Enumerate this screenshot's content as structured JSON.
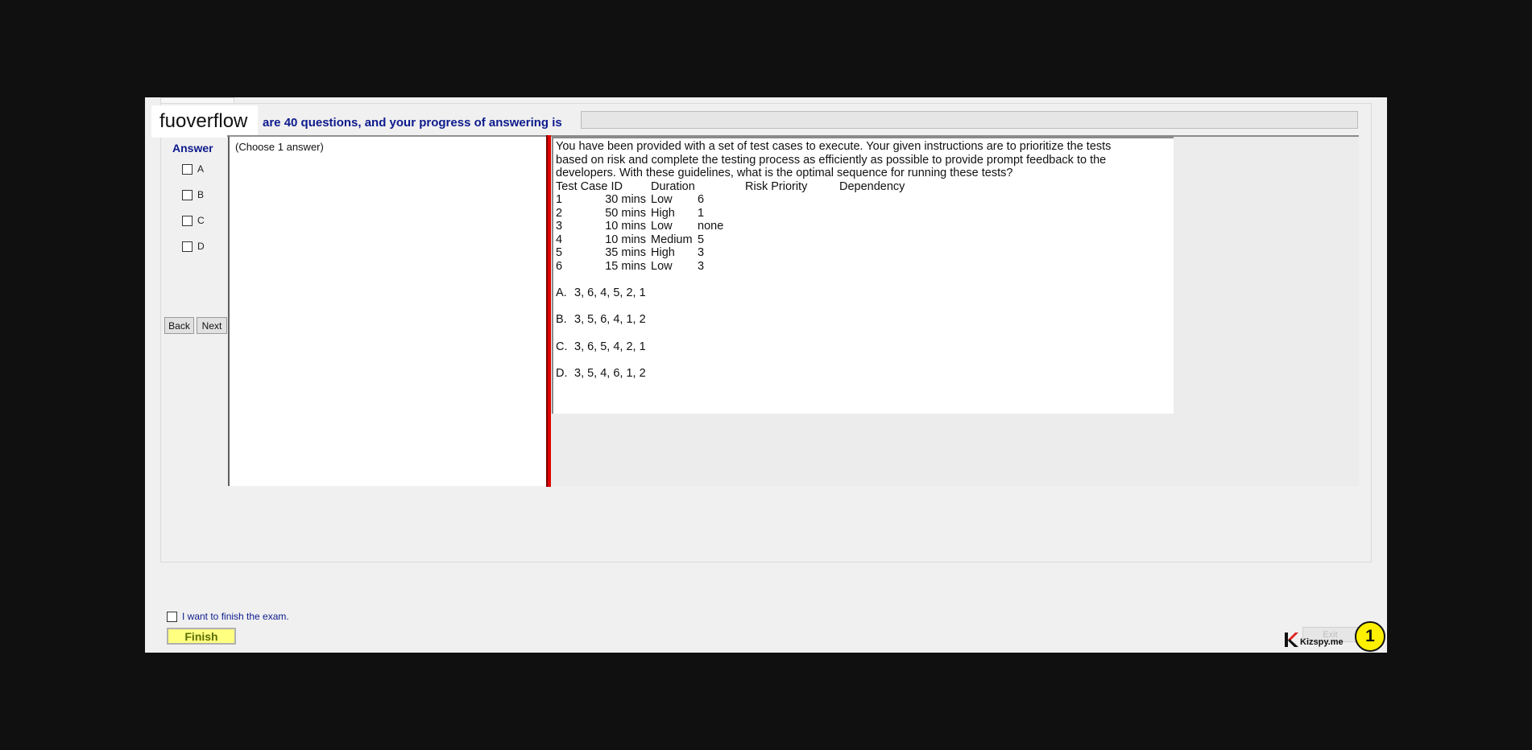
{
  "header": {
    "brand": "fuoverflow",
    "progress_label": "are 40 questions, and your progress of answering is",
    "progress_fraction": 0
  },
  "answer": {
    "title": "Answer",
    "options": [
      "A",
      "B",
      "C",
      "D"
    ],
    "choose_hint": "(Choose 1 answer)"
  },
  "nav": {
    "back_label": "Back",
    "next_label": "Next"
  },
  "question": {
    "text": "You have been provided with a set of test cases to execute. Your given instructions are to prioritize the tests based on risk and complete the testing process as efficiently as possible to provide prompt feedback to the developers. With these guidelines, what is the optimal sequence for running these tests?",
    "table_headers": [
      "Test Case ID",
      "Duration",
      "Risk Priority",
      "Dependency"
    ],
    "rows": [
      [
        "1",
        "30 mins",
        "Low",
        "6"
      ],
      [
        "2",
        "50 mins",
        "High",
        "1"
      ],
      [
        "3",
        "10 mins",
        "Low",
        "none"
      ],
      [
        "4",
        "10 mins",
        "Medium",
        "5"
      ],
      [
        "5",
        "35 mins",
        "High",
        "3"
      ],
      [
        "6",
        "15 mins",
        "Low",
        "3"
      ]
    ],
    "choices": [
      {
        "label": "A.",
        "text": "3, 6, 4, 5, 2, 1"
      },
      {
        "label": "B.",
        "text": "3, 5, 6, 4, 1, 2"
      },
      {
        "label": "C.",
        "text": "3, 6, 5, 4, 2, 1"
      },
      {
        "label": "D.",
        "text": "3, 5, 4, 6, 1, 2"
      }
    ]
  },
  "footer": {
    "finish_check_label": "I want to finish the exam.",
    "finish_button": "Finish",
    "exit_button": "Exit",
    "watermark": "Kizspy.me",
    "badge_number": "1"
  },
  "colors": {
    "accent_text": "#0d1a8c",
    "splitter": "#e00000",
    "finish_button": "#ffff80",
    "badge": "#ffef00"
  }
}
